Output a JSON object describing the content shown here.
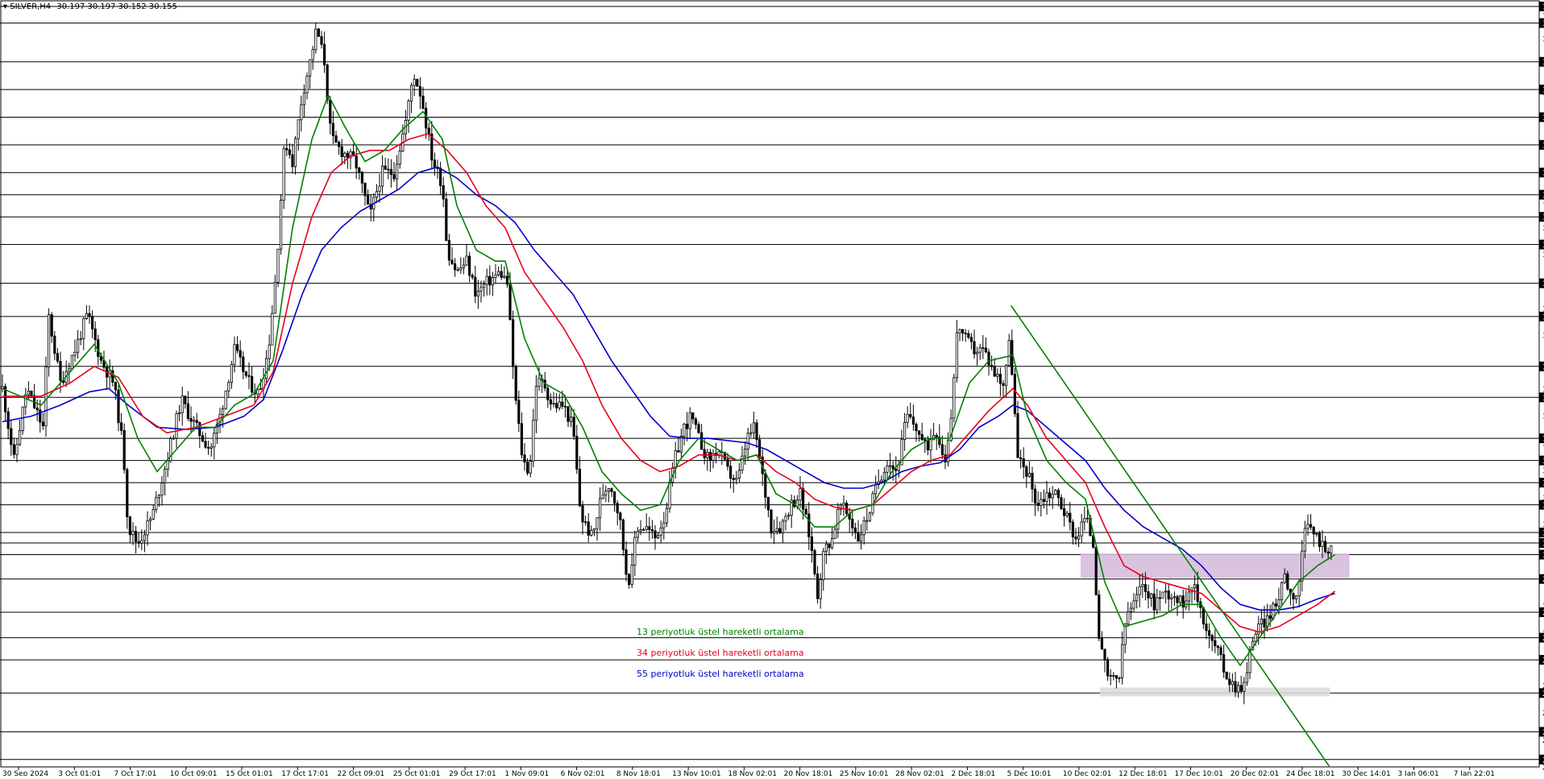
{
  "header": {
    "symbol": "SILVER,H4",
    "ohlc": "30.197 30.197 30.152 30.155"
  },
  "legend": [
    {
      "label": "13 periyotluk üstel hareketli ortalama",
      "color": "#008000"
    },
    {
      "label": "34 periyotluk üstel hareketli ortalama",
      "color": "#e8001c"
    },
    {
      "label": "55 periyotluk üstel hareketli ortalama",
      "color": "#0000c8"
    }
  ],
  "chart_data": {
    "type": "candlestick",
    "symbol": "SILVER",
    "timeframe": "H4",
    "ylim": [
      28.133,
      35.0
    ],
    "price_axis_ticks": [
      "35.000",
      "34.955",
      "34.850",
      "34.708",
      "34.500",
      "34.250",
      "34.225",
      "34.000",
      "33.983",
      "33.750",
      "33.500",
      "33.300",
      "33.248",
      "33.100",
      "33.003",
      "32.850",
      "32.763",
      "32.500",
      "32.273",
      "32.200",
      "32.033",
      "31.750",
      "31.543",
      "31.470",
      "31.303",
      "31.100",
      "31.058",
      "30.900",
      "30.813",
      "30.700",
      "30.568",
      "30.500",
      "30.328",
      "30.250",
      "30.155",
      "30.050",
      "29.830",
      "29.588",
      "29.530",
      "29.343",
      "29.300",
      "29.100",
      "28.868",
      "28.800",
      "28.623",
      "28.450",
      "28.378",
      "28.200",
      "28.133"
    ],
    "horizontal_levels": [
      35.0,
      34.85,
      34.5,
      34.25,
      34.0,
      33.75,
      33.5,
      33.3,
      33.1,
      32.85,
      32.5,
      32.2,
      31.75,
      31.47,
      31.1,
      30.9,
      30.7,
      30.5,
      30.25,
      30.155,
      30.05,
      29.83,
      29.53,
      29.3,
      29.1,
      28.8,
      28.45,
      28.2
    ],
    "highlighted_levels": [
      "35.000",
      "34.850",
      "34.500",
      "34.250",
      "34.000",
      "33.750",
      "33.500",
      "33.300",
      "33.100",
      "32.850",
      "32.500",
      "32.200",
      "31.750",
      "31.470",
      "31.100",
      "30.900",
      "30.700",
      "30.500",
      "30.250",
      "30.155",
      "30.050",
      "29.830",
      "29.530",
      "29.300",
      "29.100",
      "28.800",
      "28.450",
      "28.200"
    ],
    "time_labels": [
      "30 Sep 2024",
      "3 Oct 01:01",
      "7 Oct 17:01",
      "10 Oct 09:01",
      "15 Oct 01:01",
      "17 Oct 17:01",
      "22 Oct 09:01",
      "25 Oct 01:01",
      "29 Oct 17:01",
      "1 Nov 09:01",
      "6 Nov 02:01",
      "8 Nov 18:01",
      "13 Nov 10:01",
      "18 Nov 02:01",
      "20 Nov 18:01",
      "25 Nov 10:01",
      "28 Nov 02:01",
      "2 Dec 18:01",
      "5 Dec 10:01",
      "10 Dec 02:01",
      "12 Dec 18:01",
      "17 Dec 10:01",
      "20 Dec 02:01",
      "24 Dec 18:01",
      "30 Dec 14:01",
      "3 Jan 06:01",
      "7 Jan 22:01"
    ],
    "price_path": [
      [
        0,
        31.55
      ],
      [
        12,
        30.9
      ],
      [
        25,
        31.55
      ],
      [
        42,
        31.2
      ],
      [
        48,
        32.2
      ],
      [
        60,
        31.6
      ],
      [
        75,
        31.9
      ],
      [
        88,
        32.22
      ],
      [
        102,
        31.8
      ],
      [
        115,
        31.6
      ],
      [
        125,
        31.0
      ],
      [
        130,
        30.3
      ],
      [
        140,
        30.15
      ],
      [
        155,
        30.4
      ],
      [
        170,
        30.9
      ],
      [
        185,
        31.45
      ],
      [
        200,
        31.2
      ],
      [
        215,
        31.0
      ],
      [
        225,
        31.3
      ],
      [
        240,
        31.9
      ],
      [
        255,
        31.6
      ],
      [
        265,
        31.5
      ],
      [
        275,
        31.9
      ],
      [
        283,
        32.6
      ],
      [
        292,
        33.8
      ],
      [
        300,
        33.6
      ],
      [
        310,
        34.2
      ],
      [
        318,
        34.5
      ],
      [
        325,
        34.8
      ],
      [
        333,
        34.5
      ],
      [
        340,
        33.8
      ],
      [
        350,
        33.7
      ],
      [
        365,
        33.6
      ],
      [
        380,
        33.1
      ],
      [
        392,
        33.5
      ],
      [
        405,
        33.5
      ],
      [
        418,
        34.0
      ],
      [
        425,
        34.4
      ],
      [
        433,
        34.2
      ],
      [
        445,
        33.6
      ],
      [
        455,
        33.4
      ],
      [
        460,
        32.8
      ],
      [
        470,
        32.6
      ],
      [
        480,
        32.7
      ],
      [
        490,
        32.4
      ],
      [
        500,
        32.5
      ],
      [
        515,
        32.6
      ],
      [
        522,
        32.5
      ],
      [
        530,
        31.5
      ],
      [
        538,
        30.9
      ],
      [
        545,
        30.8
      ],
      [
        552,
        31.6
      ],
      [
        560,
        31.6
      ],
      [
        568,
        31.4
      ],
      [
        580,
        31.4
      ],
      [
        590,
        31.2
      ],
      [
        598,
        30.4
      ],
      [
        610,
        30.2
      ],
      [
        620,
        30.6
      ],
      [
        628,
        30.7
      ],
      [
        638,
        30.4
      ],
      [
        645,
        29.9
      ],
      [
        650,
        29.8
      ],
      [
        655,
        30.3
      ],
      [
        665,
        30.3
      ],
      [
        675,
        30.2
      ],
      [
        685,
        30.4
      ],
      [
        695,
        30.9
      ],
      [
        705,
        31.2
      ],
      [
        712,
        31.3
      ],
      [
        720,
        31.1
      ],
      [
        730,
        30.9
      ],
      [
        740,
        31.0
      ],
      [
        750,
        30.8
      ],
      [
        760,
        30.7
      ],
      [
        770,
        31.1
      ],
      [
        778,
        31.2
      ],
      [
        785,
        30.8
      ],
      [
        795,
        30.3
      ],
      [
        805,
        30.3
      ],
      [
        815,
        30.5
      ],
      [
        825,
        30.6
      ],
      [
        835,
        30.2
      ],
      [
        843,
        29.7
      ],
      [
        850,
        30.1
      ],
      [
        858,
        30.2
      ],
      [
        866,
        30.5
      ],
      [
        875,
        30.4
      ],
      [
        885,
        30.2
      ],
      [
        895,
        30.4
      ],
      [
        905,
        30.7
      ],
      [
        915,
        30.9
      ],
      [
        925,
        30.8
      ],
      [
        935,
        31.3
      ],
      [
        945,
        31.2
      ],
      [
        955,
        31.0
      ],
      [
        965,
        31.2
      ],
      [
        975,
        30.9
      ],
      [
        982,
        31.4
      ],
      [
        988,
        32.15
      ],
      [
        995,
        32.0
      ],
      [
        1005,
        31.9
      ],
      [
        1015,
        31.9
      ],
      [
        1025,
        31.7
      ],
      [
        1035,
        31.6
      ],
      [
        1042,
        32.0
      ],
      [
        1050,
        30.9
      ],
      [
        1060,
        30.8
      ],
      [
        1070,
        30.5
      ],
      [
        1080,
        30.6
      ],
      [
        1090,
        30.6
      ],
      [
        1100,
        30.4
      ],
      [
        1110,
        30.2
      ],
      [
        1120,
        30.4
      ],
      [
        1128,
        30.15
      ],
      [
        1135,
        29.2
      ],
      [
        1145,
        28.9
      ],
      [
        1155,
        28.95
      ],
      [
        1162,
        29.5
      ],
      [
        1170,
        29.6
      ],
      [
        1180,
        29.8
      ],
      [
        1190,
        29.6
      ],
      [
        1200,
        29.7
      ],
      [
        1210,
        29.7
      ],
      [
        1220,
        29.6
      ],
      [
        1230,
        29.8
      ],
      [
        1238,
        29.6
      ],
      [
        1248,
        29.3
      ],
      [
        1256,
        29.2
      ],
      [
        1264,
        29.0
      ],
      [
        1270,
        28.9
      ],
      [
        1278,
        28.85
      ],
      [
        1286,
        28.9
      ],
      [
        1292,
        29.3
      ],
      [
        1300,
        29.4
      ],
      [
        1310,
        29.5
      ],
      [
        1318,
        29.6
      ],
      [
        1325,
        29.9
      ],
      [
        1332,
        29.7
      ],
      [
        1340,
        29.7
      ],
      [
        1345,
        30.2
      ],
      [
        1352,
        30.3
      ],
      [
        1360,
        30.2
      ],
      [
        1368,
        30.1
      ],
      [
        1375,
        30.15
      ]
    ],
    "ema13_path": [
      [
        0,
        31.55
      ],
      [
        40,
        31.4
      ],
      [
        70,
        31.7
      ],
      [
        95,
        31.95
      ],
      [
        120,
        31.6
      ],
      [
        140,
        31.1
      ],
      [
        160,
        30.8
      ],
      [
        180,
        31.0
      ],
      [
        200,
        31.2
      ],
      [
        220,
        31.2
      ],
      [
        240,
        31.4
      ],
      [
        260,
        31.5
      ],
      [
        280,
        31.8
      ],
      [
        300,
        33.0
      ],
      [
        320,
        33.8
      ],
      [
        337,
        34.2
      ],
      [
        355,
        33.9
      ],
      [
        375,
        33.6
      ],
      [
        395,
        33.7
      ],
      [
        415,
        33.9
      ],
      [
        435,
        34.05
      ],
      [
        455,
        33.8
      ],
      [
        470,
        33.2
      ],
      [
        490,
        32.8
      ],
      [
        510,
        32.7
      ],
      [
        520,
        32.7
      ],
      [
        540,
        32.0
      ],
      [
        560,
        31.6
      ],
      [
        580,
        31.5
      ],
      [
        600,
        31.2
      ],
      [
        620,
        30.8
      ],
      [
        640,
        30.6
      ],
      [
        660,
        30.45
      ],
      [
        680,
        30.5
      ],
      [
        700,
        30.9
      ],
      [
        720,
        31.1
      ],
      [
        740,
        31.0
      ],
      [
        760,
        30.9
      ],
      [
        780,
        30.95
      ],
      [
        800,
        30.6
      ],
      [
        820,
        30.5
      ],
      [
        840,
        30.3
      ],
      [
        860,
        30.3
      ],
      [
        880,
        30.45
      ],
      [
        900,
        30.5
      ],
      [
        920,
        30.8
      ],
      [
        940,
        31.0
      ],
      [
        960,
        31.1
      ],
      [
        980,
        31.1
      ],
      [
        1000,
        31.6
      ],
      [
        1020,
        31.8
      ],
      [
        1045,
        31.85
      ],
      [
        1060,
        31.3
      ],
      [
        1080,
        30.9
      ],
      [
        1100,
        30.7
      ],
      [
        1120,
        30.55
      ],
      [
        1140,
        29.8
      ],
      [
        1160,
        29.4
      ],
      [
        1180,
        29.45
      ],
      [
        1200,
        29.5
      ],
      [
        1220,
        29.6
      ],
      [
        1240,
        29.6
      ],
      [
        1260,
        29.3
      ],
      [
        1280,
        29.05
      ],
      [
        1300,
        29.3
      ],
      [
        1320,
        29.55
      ],
      [
        1340,
        29.8
      ],
      [
        1360,
        29.95
      ],
      [
        1378,
        30.05
      ]
    ],
    "ema34_path": [
      [
        0,
        31.48
      ],
      [
        40,
        31.48
      ],
      [
        70,
        31.6
      ],
      [
        95,
        31.75
      ],
      [
        120,
        31.65
      ],
      [
        145,
        31.3
      ],
      [
        170,
        31.15
      ],
      [
        200,
        31.2
      ],
      [
        230,
        31.3
      ],
      [
        260,
        31.4
      ],
      [
        280,
        31.7
      ],
      [
        300,
        32.5
      ],
      [
        320,
        33.1
      ],
      [
        340,
        33.5
      ],
      [
        360,
        33.65
      ],
      [
        380,
        33.7
      ],
      [
        400,
        33.7
      ],
      [
        420,
        33.8
      ],
      [
        440,
        33.85
      ],
      [
        460,
        33.7
      ],
      [
        480,
        33.5
      ],
      [
        500,
        33.2
      ],
      [
        520,
        33.0
      ],
      [
        540,
        32.6
      ],
      [
        560,
        32.35
      ],
      [
        580,
        32.1
      ],
      [
        600,
        31.8
      ],
      [
        620,
        31.4
      ],
      [
        640,
        31.1
      ],
      [
        660,
        30.9
      ],
      [
        680,
        30.8
      ],
      [
        700,
        30.85
      ],
      [
        720,
        30.95
      ],
      [
        740,
        30.95
      ],
      [
        760,
        30.9
      ],
      [
        780,
        30.95
      ],
      [
        800,
        30.8
      ],
      [
        820,
        30.7
      ],
      [
        840,
        30.55
      ],
      [
        860,
        30.48
      ],
      [
        880,
        30.45
      ],
      [
        900,
        30.5
      ],
      [
        920,
        30.65
      ],
      [
        940,
        30.8
      ],
      [
        960,
        30.9
      ],
      [
        980,
        30.95
      ],
      [
        1000,
        31.15
      ],
      [
        1020,
        31.35
      ],
      [
        1045,
        31.55
      ],
      [
        1060,
        31.4
      ],
      [
        1080,
        31.1
      ],
      [
        1100,
        30.9
      ],
      [
        1120,
        30.7
      ],
      [
        1140,
        30.3
      ],
      [
        1160,
        29.95
      ],
      [
        1180,
        29.85
      ],
      [
        1200,
        29.8
      ],
      [
        1220,
        29.75
      ],
      [
        1240,
        29.7
      ],
      [
        1260,
        29.55
      ],
      [
        1280,
        29.4
      ],
      [
        1300,
        29.35
      ],
      [
        1320,
        29.4
      ],
      [
        1340,
        29.5
      ],
      [
        1360,
        29.6
      ],
      [
        1378,
        29.72
      ]
    ],
    "ema55_path": [
      [
        0,
        31.25
      ],
      [
        30,
        31.3
      ],
      [
        60,
        31.4
      ],
      [
        90,
        31.52
      ],
      [
        110,
        31.55
      ],
      [
        130,
        31.4
      ],
      [
        160,
        31.2
      ],
      [
        190,
        31.18
      ],
      [
        220,
        31.2
      ],
      [
        250,
        31.3
      ],
      [
        270,
        31.45
      ],
      [
        290,
        31.9
      ],
      [
        310,
        32.4
      ],
      [
        330,
        32.8
      ],
      [
        350,
        33.0
      ],
      [
        370,
        33.15
      ],
      [
        390,
        33.25
      ],
      [
        410,
        33.35
      ],
      [
        430,
        33.5
      ],
      [
        450,
        33.55
      ],
      [
        470,
        33.45
      ],
      [
        490,
        33.3
      ],
      [
        510,
        33.2
      ],
      [
        530,
        33.05
      ],
      [
        550,
        32.8
      ],
      [
        570,
        32.6
      ],
      [
        590,
        32.4
      ],
      [
        610,
        32.1
      ],
      [
        630,
        31.8
      ],
      [
        650,
        31.55
      ],
      [
        670,
        31.3
      ],
      [
        690,
        31.12
      ],
      [
        710,
        31.1
      ],
      [
        730,
        31.1
      ],
      [
        750,
        31.08
      ],
      [
        770,
        31.06
      ],
      [
        790,
        31.0
      ],
      [
        810,
        30.9
      ],
      [
        830,
        30.8
      ],
      [
        850,
        30.7
      ],
      [
        870,
        30.65
      ],
      [
        890,
        30.65
      ],
      [
        910,
        30.7
      ],
      [
        930,
        30.8
      ],
      [
        950,
        30.85
      ],
      [
        970,
        30.88
      ],
      [
        990,
        31.0
      ],
      [
        1010,
        31.2
      ],
      [
        1030,
        31.3
      ],
      [
        1045,
        31.4
      ],
      [
        1060,
        31.35
      ],
      [
        1080,
        31.2
      ],
      [
        1100,
        31.05
      ],
      [
        1120,
        30.9
      ],
      [
        1140,
        30.65
      ],
      [
        1160,
        30.45
      ],
      [
        1180,
        30.3
      ],
      [
        1200,
        30.2
      ],
      [
        1220,
        30.1
      ],
      [
        1240,
        29.95
      ],
      [
        1260,
        29.75
      ],
      [
        1280,
        29.6
      ],
      [
        1300,
        29.55
      ],
      [
        1320,
        29.55
      ],
      [
        1340,
        29.58
      ],
      [
        1360,
        29.65
      ],
      [
        1378,
        29.7
      ]
    ],
    "trendline": {
      "start": [
        1043,
        32.3
      ],
      "end": [
        1372,
        28.14
      ],
      "color": "#008000"
    },
    "zones": [
      {
        "x": [
          1115,
          1393
        ],
        "y": [
          29.84,
          30.06
        ],
        "color": "#d6bcdb"
      },
      {
        "x": [
          1135,
          1373
        ],
        "y": [
          28.77,
          28.85
        ],
        "color": "#dcdcdc"
      }
    ],
    "colors": {
      "candle": "#000000",
      "grid_line": "#000000",
      "axis_label_bg": "#000000",
      "axis_label_text": "#ffffff"
    },
    "grid": false
  }
}
